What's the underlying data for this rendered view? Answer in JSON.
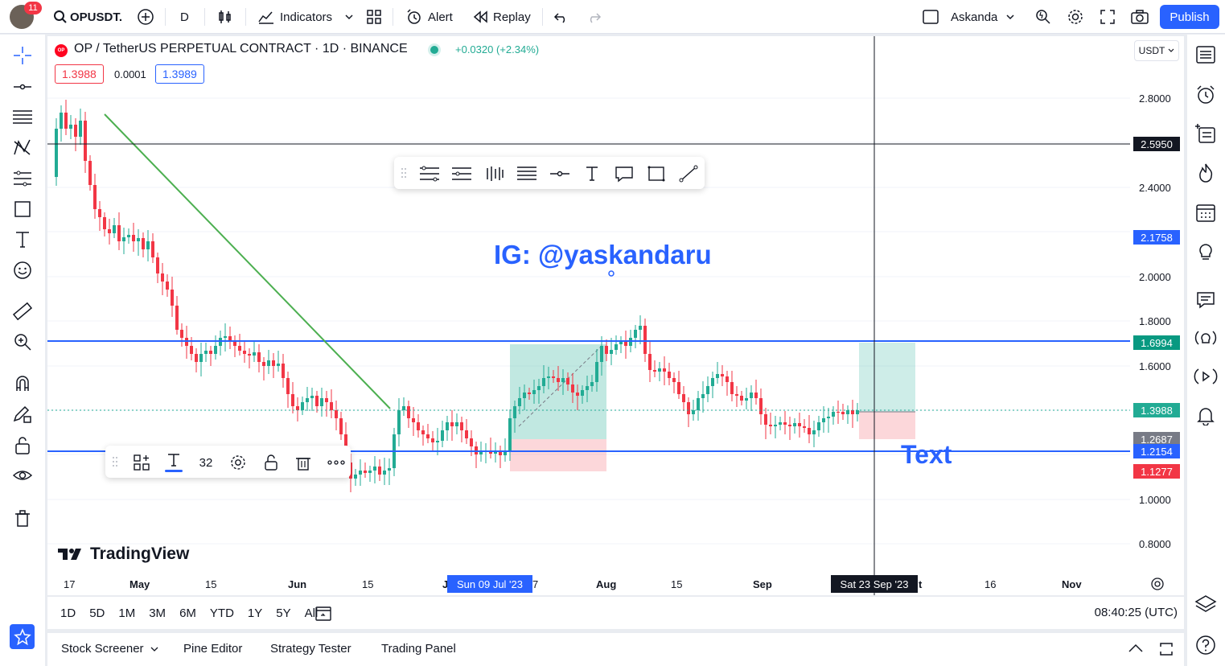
{
  "topbar": {
    "notif_count": "11",
    "symbol": "OPUSDT.",
    "interval": "D",
    "indicators": "Indicators",
    "alert": "Alert",
    "replay": "Replay",
    "layout_name": "Askanda",
    "publish": "Publish"
  },
  "legend": {
    "title": "OP / TetherUS PERPETUAL CONTRACT · 1D · BINANCE",
    "change": "+0.0320 (+2.34%)",
    "bid": "1.3988",
    "spread": "0.0001",
    "ask": "1.3989"
  },
  "currency": "USDT",
  "price_axis": [
    "2.8000",
    "2.4000",
    "2.0000",
    "1.8000",
    "1.6000",
    "1.0000",
    "0.8000"
  ],
  "price_tags": {
    "crosshair": "2.5950",
    "blue_line_upper_hidden": "2.1758",
    "upper_level": "1.6994",
    "last": "1.3988",
    "position_entry": "1.2687",
    "lower_level": "1.2154",
    "position_stop": "1.1277"
  },
  "time_axis": [
    "17",
    "May",
    "15",
    "Jun",
    "15",
    "J",
    "7",
    "Aug",
    "15",
    "Sep",
    "t",
    "16",
    "Nov"
  ],
  "time_tags": {
    "left": "Sun 09 Jul '23",
    "right": "Sat 23 Sep '23"
  },
  "annotations": {
    "ig_text": "IG: @yaskandaru",
    "text_label": "Text"
  },
  "text_toolbar": {
    "font_size": "32"
  },
  "watermark": "TradingView",
  "ranges": [
    "1D",
    "5D",
    "1M",
    "3M",
    "6M",
    "YTD",
    "1Y",
    "5Y",
    "All"
  ],
  "clock": "08:40:25 (UTC)",
  "footer_tabs": [
    "Stock Screener",
    "Pine Editor",
    "Strategy Tester",
    "Trading Panel"
  ],
  "colors": {
    "up": "#22ab94",
    "down": "#f23645",
    "accent": "#2962ff",
    "trend": "#4caf50"
  }
}
